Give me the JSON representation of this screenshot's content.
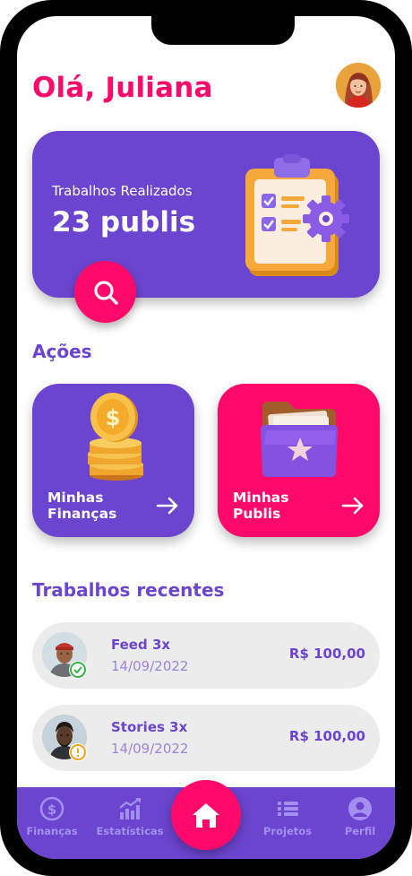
{
  "header": {
    "greeting": "Olá, Juliana"
  },
  "summary": {
    "label": "Trabalhos Realizados",
    "value": "23 publis"
  },
  "actions": {
    "title": "Ações",
    "items": [
      {
        "line1": "Minhas",
        "line2": "Finanças"
      },
      {
        "line1": "Minhas",
        "line2": "Publis"
      }
    ]
  },
  "recent": {
    "title": "Trabalhos recentes",
    "items": [
      {
        "title": "Feed 3x",
        "date": "14/09/2022",
        "price": "R$ 100,00",
        "status": "check-icon"
      },
      {
        "title": "Stories 3x",
        "date": "14/09/2022",
        "price": "R$ 100,00",
        "status": "warning-icon"
      }
    ]
  },
  "nav": {
    "items": [
      {
        "label": "Finanças",
        "icon": "money-icon"
      },
      {
        "label": "Estatísticas",
        "icon": "chart-icon"
      },
      {
        "label": "Projetos",
        "icon": "list-icon"
      },
      {
        "label": "Perfil",
        "icon": "user-icon"
      }
    ],
    "home_icon": "home-icon"
  },
  "colors": {
    "primary": "#6b45cf",
    "accent": "#ff0a6b",
    "success": "#36b24a",
    "warning": "#f2a51a",
    "card_gray": "#ececec"
  }
}
